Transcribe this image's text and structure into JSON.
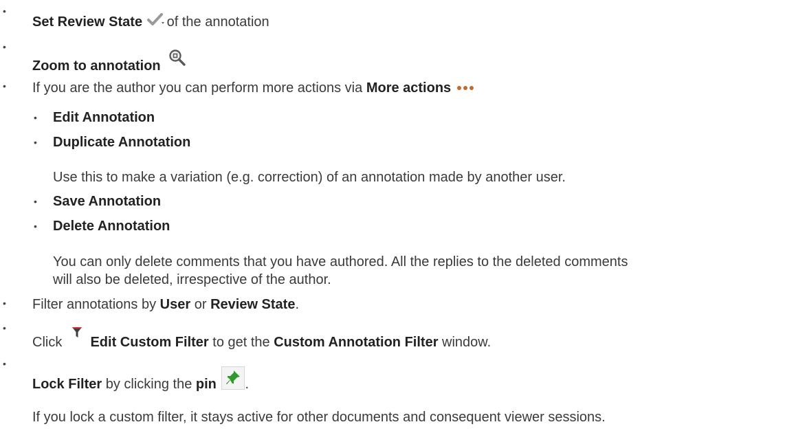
{
  "items": {
    "review": {
      "label": "Set Review State",
      "suffix": "of the annotation",
      "icon": "check-dropdown-icon"
    },
    "zoom": {
      "label": "Zoom to annotation",
      "icon": "magnifier-icon"
    },
    "more": {
      "prefix": "If you are the author you can perform more actions via",
      "label": "More actions",
      "icon": "more-dots-icon"
    },
    "sub": [
      {
        "label": "Edit Annotation"
      },
      {
        "label": "Duplicate Annotation",
        "note": "Use this to make a variation (e.g. correction) of an annotation made by another user."
      },
      {
        "label": "Save Annotation"
      },
      {
        "label": "Delete Annotation",
        "note_line1": "You can only delete comments that you have authored. All the replies to the deleted comments",
        "note_line2": "will also be deleted, irrespective of the author."
      }
    ],
    "filter": {
      "prefix": "Filter annotations by",
      "user": "User",
      "or": "or",
      "state": "Review State",
      "end": "."
    },
    "custom": {
      "prefix": "Click",
      "label": "Edit Custom Filter",
      "mid": "to get the",
      "window": "Custom Annotation Filter",
      "end": "window.",
      "icon": "funnel-icon"
    },
    "lock": {
      "label": "Lock Filter",
      "mid": "by clicking the",
      "pin": "pin",
      "end": ".",
      "icon": "pin-icon",
      "note": "If you lock a custom filter, it stays active for other documents and consequent viewer sessions."
    }
  }
}
